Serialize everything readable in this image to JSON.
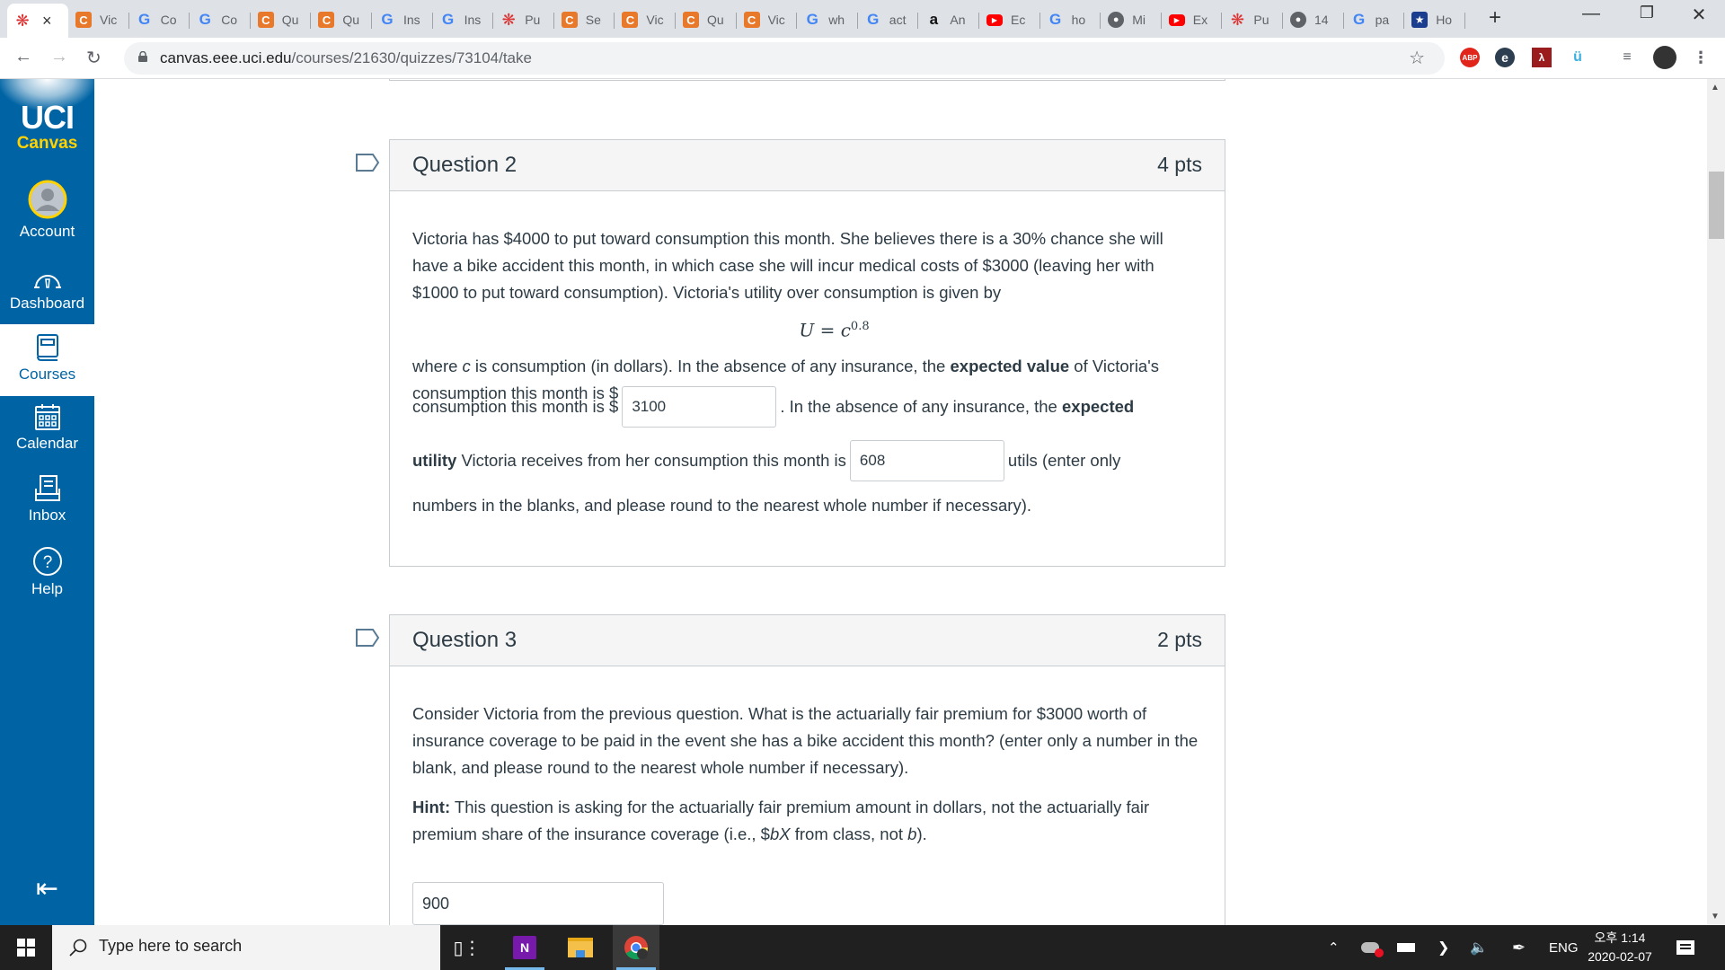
{
  "browser": {
    "tabs": [
      {
        "icon": "canvas-icon",
        "title": "",
        "active": true
      },
      {
        "icon": "c-icon",
        "title": "Vic"
      },
      {
        "icon": "google-icon",
        "title": "Co"
      },
      {
        "icon": "google-icon",
        "title": "Co"
      },
      {
        "icon": "c-icon",
        "title": "Qu"
      },
      {
        "icon": "c-icon",
        "title": "Qu"
      },
      {
        "icon": "google-icon",
        "title": "Ins"
      },
      {
        "icon": "google-icon",
        "title": "Ins"
      },
      {
        "icon": "canvas-icon",
        "title": "Pu"
      },
      {
        "icon": "c-icon",
        "title": "Se"
      },
      {
        "icon": "c-icon",
        "title": "Vic"
      },
      {
        "icon": "c-icon",
        "title": "Qu"
      },
      {
        "icon": "c-icon",
        "title": "Vic"
      },
      {
        "icon": "google-icon",
        "title": "wh"
      },
      {
        "icon": "google-icon",
        "title": "act"
      },
      {
        "icon": "amazon-icon",
        "title": "An"
      },
      {
        "icon": "youtube-icon",
        "title": "Ec"
      },
      {
        "icon": "google-icon",
        "title": "ho"
      },
      {
        "icon": "globe-icon",
        "title": "Mi"
      },
      {
        "icon": "youtube-icon",
        "title": "Ex"
      },
      {
        "icon": "canvas-icon",
        "title": "Pu"
      },
      {
        "icon": "globe-icon",
        "title": "14"
      },
      {
        "icon": "google-icon",
        "title": "pa"
      },
      {
        "icon": "star-shield-icon",
        "title": "Ho"
      }
    ],
    "close_tab": "×",
    "new_tab": "+",
    "url_host": "canvas.eee.uci.edu",
    "url_path": "/courses/21630/quizzes/73104/take",
    "extensions": [
      "ABP",
      "e",
      "acrobat",
      "owl"
    ]
  },
  "sidebar": {
    "logo_top": "UCI",
    "logo_bottom": "Canvas",
    "items": [
      {
        "label": "Account",
        "icon": "account-avatar-icon"
      },
      {
        "label": "Dashboard",
        "icon": "dashboard-icon"
      },
      {
        "label": "Courses",
        "icon": "courses-icon",
        "active": true
      },
      {
        "label": "Calendar",
        "icon": "calendar-icon"
      },
      {
        "label": "Inbox",
        "icon": "inbox-icon"
      },
      {
        "label": "Help",
        "icon": "help-icon"
      }
    ],
    "collapse": "collapse-nav-icon"
  },
  "questions": [
    {
      "name": "Question 2",
      "points": "4 pts",
      "text_1": "Victoria has $4000 to put toward consumption this month. She believes there is a 30% chance she will have a bike accident this month, in which case she will incur medical costs of $3000 (leaving her with $1000 to put toward consumption). Victoria's utility over consumption is given by",
      "formula_lhs": "U = c",
      "formula_exp": "0.8",
      "text_2a": "where ",
      "text_2var": "c",
      "text_2b": " is consumption (in dollars). In the absence of any insurance, the ",
      "bold_1": "expected value",
      "text_2c": " of Victoria's consumption this month is $",
      "blank_1": "3100",
      "text_3a": ". In the absence of any insurance, the ",
      "bold_2": "expected utility",
      "text_3b": " Victoria receives from her consumption this month is",
      "blank_2": "608",
      "text_4": "utils (enter only numbers in the blanks, and please round to the nearest whole number if necessary)."
    },
    {
      "name": "Question 3",
      "points": "2 pts",
      "text_1": "Consider Victoria from the previous question. What is the actuarially fair premium for $3000 worth of insurance coverage to be paid in the event she has a bike accident this month? (enter only a number in the blank, and please round to the nearest whole number if necessary).",
      "hint_label": "Hint:",
      "hint_a": " This question is asking for the actuarially fair premium amount in dollars, not the actuarially fair premium share of the insurance coverage (i.e., $",
      "hint_var1": "bX",
      "hint_b": " from class, not ",
      "hint_var2": "b",
      "hint_c": ").",
      "answer": "900"
    }
  ],
  "taskbar": {
    "search_placeholder": "Type here to search",
    "apps": [
      "task-view-icon",
      "onenote-icon",
      "file-explorer-icon",
      "chrome-icon"
    ],
    "language": "ENG",
    "time": "오후 1:14",
    "date": "2020-02-07"
  }
}
